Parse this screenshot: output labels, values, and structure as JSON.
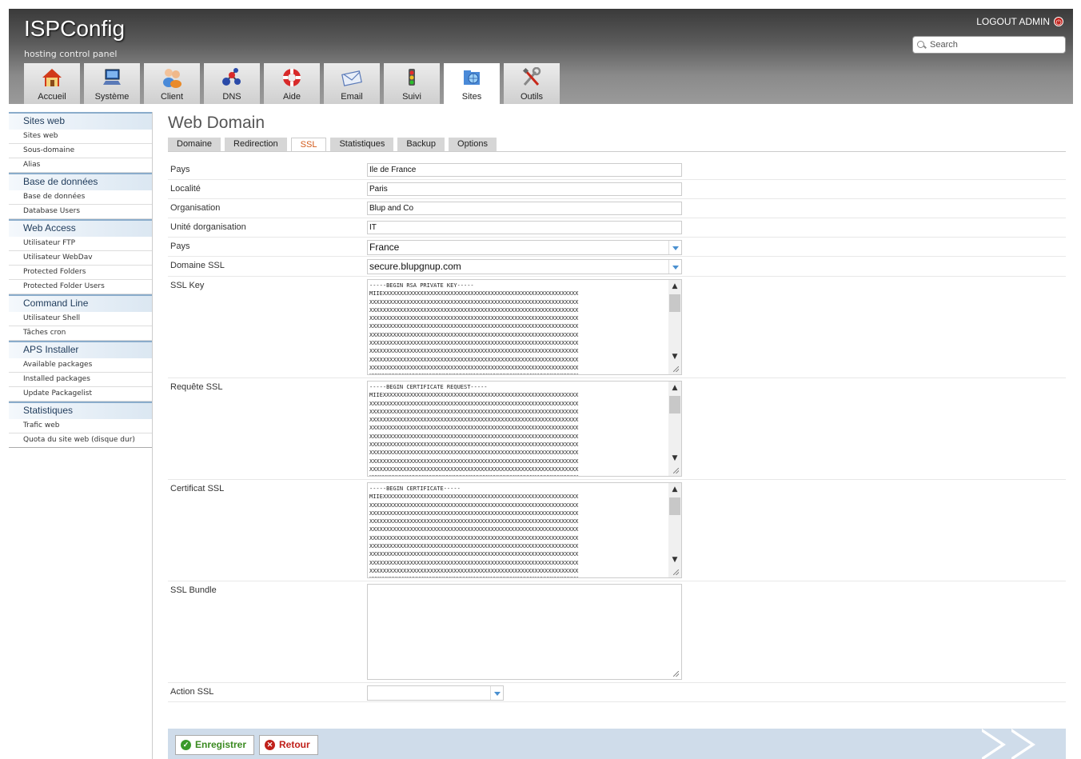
{
  "header": {
    "logo": "ISPConfig",
    "slogan": "hosting control panel",
    "logout": "LOGOUT ADMIN",
    "search_placeholder": "Search"
  },
  "tabs": [
    {
      "label": "Accueil",
      "icon": "home-icon"
    },
    {
      "label": "Système",
      "icon": "computer-icon"
    },
    {
      "label": "Client",
      "icon": "users-icon"
    },
    {
      "label": "DNS",
      "icon": "dns-network-icon"
    },
    {
      "label": "Aide",
      "icon": "lifebuoy-icon"
    },
    {
      "label": "Email",
      "icon": "envelope-icon"
    },
    {
      "label": "Suivi",
      "icon": "traffic-light-icon"
    },
    {
      "label": "Sites",
      "icon": "sites-folder-icon",
      "active": true
    },
    {
      "label": "Outils",
      "icon": "tools-icon"
    }
  ],
  "sidebar": {
    "groups": [
      {
        "title": "Sites web",
        "items": [
          "Sites web",
          "Sous-domaine",
          "Alias"
        ]
      },
      {
        "title": "Base de données",
        "items": [
          "Base de données",
          "Database Users"
        ]
      },
      {
        "title": "Web Access",
        "items": [
          "Utilisateur FTP",
          "Utilisateur WebDav",
          "Protected Folders",
          "Protected Folder Users"
        ]
      },
      {
        "title": "Command Line",
        "items": [
          "Utilisateur Shell",
          "Tâches cron"
        ]
      },
      {
        "title": "APS Installer",
        "items": [
          "Available packages",
          "Installed packages",
          "Update Packagelist"
        ]
      },
      {
        "title": "Statistiques",
        "items": [
          "Trafic web",
          "Quota du site web (disque dur)"
        ]
      }
    ]
  },
  "main": {
    "title": "Web Domain",
    "subtabs": [
      "Domaine",
      "Redirection",
      "SSL",
      "Statistiques",
      "Backup",
      "Options"
    ],
    "active_subtab": "SSL",
    "fields": {
      "state_label": "Pays",
      "state_value": "Ile de France",
      "locality_label": "Localité",
      "locality_value": "Paris",
      "org_label": "Organisation",
      "org_value": "Blup and Co",
      "orgunit_label": "Unité dorganisation",
      "orgunit_value": "IT",
      "country_label": "Pays",
      "country_value": "France",
      "ssl_domain_label": "Domaine SSL",
      "ssl_domain_value": "secure.blupgnup.com",
      "ssl_key_label": "SSL Key",
      "ssl_key_value": "-----BEGIN RSA PRIVATE KEY-----\nMIIEXXXXXXXXXXXXXXXXXXXXXXXXXXXXXXXXXXXXXXXXXXXXXXXXXXXXXXXXXX\nXXXXXXXXXXXXXXXXXXXXXXXXXXXXXXXXXXXXXXXXXXXXXXXXXXXXXXXXXXXXXX\nXXXXXXXXXXXXXXXXXXXXXXXXXXXXXXXXXXXXXXXXXXXXXXXXXXXXXXXXXXXXXX\nXXXXXXXXXXXXXXXXXXXXXXXXXXXXXXXXXXXXXXXXXXXXXXXXXXXXXXXXXXXXXX\nXXXXXXXXXXXXXXXXXXXXXXXXXXXXXXXXXXXXXXXXXXXXXXXXXXXXXXXXXXXXXX\nXXXXXXXXXXXXXXXXXXXXXXXXXXXXXXXXXXXXXXXXXXXXXXXXXXXXXXXXXXXXXX\nXXXXXXXXXXXXXXXXXXXXXXXXXXXXXXXXXXXXXXXXXXXXXXXXXXXXXXXXXXXXXX\nXXXXXXXXXXXXXXXXXXXXXXXXXXXXXXXXXXXXXXXXXXXXXXXXXXXXXXXXXXXXXX\nXXXXXXXXXXXXXXXXXXXXXXXXXXXXXXXXXXXXXXXXXXXXXXXXXXXXXXXXXXXXXX\nXXXXXXXXXXXXXXXXXXXXXXXXXXXXXXXXXXXXXXXXXXXXXXXXXXXXXXXXXXXXXX\nXXXXXXXXXXXXXXXXXXXXXXXXXXXXXXXXXXXXXXXXXXXXXXXXXXXXXXXXXXXXXX",
      "ssl_request_label": "Requête SSL",
      "ssl_request_value": "-----BEGIN CERTIFICATE REQUEST-----\nMIIEXXXXXXXXXXXXXXXXXXXXXXXXXXXXXXXXXXXXXXXXXXXXXXXXXXXXXXXXXX\nXXXXXXXXXXXXXXXXXXXXXXXXXXXXXXXXXXXXXXXXXXXXXXXXXXXXXXXXXXXXXX\nXXXXXXXXXXXXXXXXXXXXXXXXXXXXXXXXXXXXXXXXXXXXXXXXXXXXXXXXXXXXXX\nXXXXXXXXXXXXXXXXXXXXXXXXXXXXXXXXXXXXXXXXXXXXXXXXXXXXXXXXXXXXXX\nXXXXXXXXXXXXXXXXXXXXXXXXXXXXXXXXXXXXXXXXXXXXXXXXXXXXXXXXXXXXXX\nXXXXXXXXXXXXXXXXXXXXXXXXXXXXXXXXXXXXXXXXXXXXXXXXXXXXXXXXXXXXXX\nXXXXXXXXXXXXXXXXXXXXXXXXXXXXXXXXXXXXXXXXXXXXXXXXXXXXXXXXXXXXXX\nXXXXXXXXXXXXXXXXXXXXXXXXXXXXXXXXXXXXXXXXXXXXXXXXXXXXXXXXXXXXXX\nXXXXXXXXXXXXXXXXXXXXXXXXXXXXXXXXXXXXXXXXXXXXXXXXXXXXXXXXXXXXXX\nXXXXXXXXXXXXXXXXXXXXXXXXXXXXXXXXXXXXXXXXXXXXXXXXXXXXXXXXXXXXXX\nXXXXXXXXXXXXXXXXXXXXXXXXXXXXXXXXXXXXXXXXXXXXXXXXXXXXXXXXXXXXXX",
      "ssl_cert_label": "Certificat SSL",
      "ssl_cert_value": "-----BEGIN CERTIFICATE-----\nMIIEXXXXXXXXXXXXXXXXXXXXXXXXXXXXXXXXXXXXXXXXXXXXXXXXXXXXXXXXXX\nXXXXXXXXXXXXXXXXXXXXXXXXXXXXXXXXXXXXXXXXXXXXXXXXXXXXXXXXXXXXXX\nXXXXXXXXXXXXXXXXXXXXXXXXXXXXXXXXXXXXXXXXXXXXXXXXXXXXXXXXXXXXXX\nXXXXXXXXXXXXXXXXXXXXXXXXXXXXXXXXXXXXXXXXXXXXXXXXXXXXXXXXXXXXXX\nXXXXXXXXXXXXXXXXXXXXXXXXXXXXXXXXXXXXXXXXXXXXXXXXXXXXXXXXXXXXXX\nXXXXXXXXXXXXXXXXXXXXXXXXXXXXXXXXXXXXXXXXXXXXXXXXXXXXXXXXXXXXXX\nXXXXXXXXXXXXXXXXXXXXXXXXXXXXXXXXXXXXXXXXXXXXXXXXXXXXXXXXXXXXXX\nXXXXXXXXXXXXXXXXXXXXXXXXXXXXXXXXXXXXXXXXXXXXXXXXXXXXXXXXXXXXXX\nXXXXXXXXXXXXXXXXXXXXXXXXXXXXXXXXXXXXXXXXXXXXXXXXXXXXXXXXXXXXXX\nXXXXXXXXXXXXXXXXXXXXXXXXXXXXXXXXXXXXXXXXXXXXXXXXXXXXXXXXXXXXXX\nXXXXXXXXXXXXXXXXXXXXXXXXXXXXXXXXXXXXXXXXXXXXXXXXXXXXXXXXXXXXXX",
      "ssl_bundle_label": "SSL Bundle",
      "ssl_bundle_value": "",
      "ssl_action_label": "Action SSL",
      "ssl_action_value": ""
    },
    "buttons": {
      "save": "Enregistrer",
      "back": "Retour"
    }
  },
  "colors": {
    "active_subtab": "#d35a1a",
    "sidebar_header_border": "#8aaccb",
    "footer_bar": "#cfdcea",
    "save_green": "#3a8a20",
    "back_red": "#c0201a"
  }
}
